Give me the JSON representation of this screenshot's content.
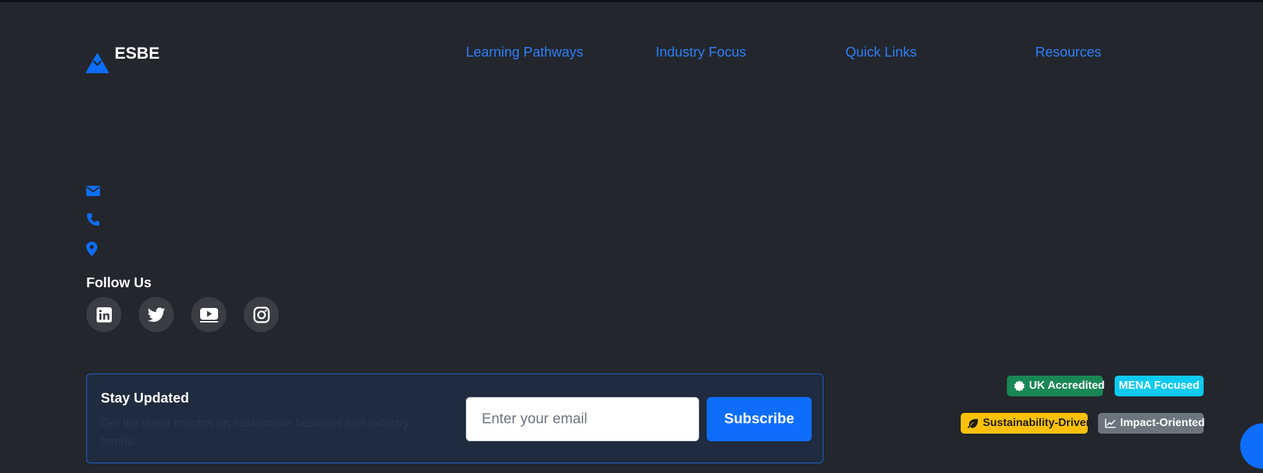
{
  "brand": {
    "name": "ESBE",
    "logo_icon": "mountain-icon"
  },
  "footer_columns": [
    {
      "title": "Learning Pathways"
    },
    {
      "title": "Industry Focus"
    },
    {
      "title": "Quick Links"
    },
    {
      "title": "Resources"
    }
  ],
  "contact": {
    "icons": [
      "envelope-icon",
      "phone-icon",
      "map-pin-icon"
    ]
  },
  "follow": {
    "title": "Follow Us",
    "socials": [
      "linkedin-icon",
      "twitter-icon",
      "youtube-icon",
      "instagram-icon"
    ]
  },
  "newsletter": {
    "title": "Stay Updated",
    "description": "Get the latest insights on sustainable business and industry trends.",
    "email_placeholder": "Enter your email",
    "subscribe_label": "Subscribe"
  },
  "badges": {
    "uk": "UK Accredited",
    "mena": "MENA Focused",
    "sustainability": "Sustainability-Driven",
    "impact": "Impact-Oriented"
  },
  "colors": {
    "background": "#23262c",
    "accent": "#0d6efd",
    "link": "#2d7ff9",
    "success": "#198754",
    "info": "#0dcaf0",
    "warning": "#ffc107",
    "secondary": "#6c757d"
  }
}
